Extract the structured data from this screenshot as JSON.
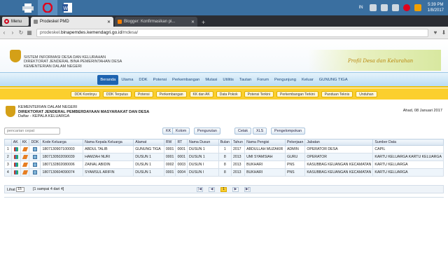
{
  "taskbar": {
    "apps": [
      {
        "name": "printer"
      },
      {
        "name": "opera",
        "active": true
      },
      {
        "name": "word"
      }
    ],
    "lang": "IN",
    "time": "5:39 PM",
    "date": "1/8/2017"
  },
  "browser": {
    "menu_label": "Menu",
    "tabs": [
      {
        "title": "Prodeskel PMD",
        "active": true
      },
      {
        "title": "Blogger: Konfirmasikan pi...",
        "active": false
      }
    ],
    "url_prefix": "prodeskel.",
    "url_host": "binapemdes.kemendagri.go.id",
    "url_path": "/mdesa/"
  },
  "header": {
    "line1": "SISTEM INFORMASI DESA DAN KELURAHAN",
    "line2": "DIREKTORAT JENDERAL BINA PEMERINTAHAN DESA",
    "line3": "KEMENTERIAN DALAM NEGERI",
    "banner": "Profil Desa dan Kelurahan"
  },
  "main_nav": [
    "Beranda",
    "Utama",
    "DDK",
    "Potensi",
    "Perkembangan",
    "Mutasi",
    "Utilitis",
    "Tautan",
    "Forum",
    "Pengunjung",
    "Keluar",
    "GUNUNG TIGA"
  ],
  "main_nav_active": "Beranda",
  "sub_nav": [
    "DDK Kontinyu",
    "DDK Terputus",
    "Potensi",
    "Perkembangan",
    "KK dan AK",
    "Data Pokok",
    "Potensi Terkini",
    "Perkembangan Terkini",
    "Panduan Teknis",
    "Unduhan"
  ],
  "context": {
    "org1": "KEMENTERIAN DALAM NEGERI",
    "org2": "DIREKTORAT JENDERAL PEMBERDAYAAN MASYARAKAT DAN DESA",
    "subtitle": "Daftar - KEPALA KELUARGA",
    "date": "Ahad, 08 Januari 2017"
  },
  "toolbar": {
    "search_placeholder": "pencarian cepat",
    "kk_baru": "KK Baru",
    "kolom": "Kolom",
    "pengurutan": "Pengurutan",
    "cetak": "Cetak",
    "xls": "XLS",
    "pengelompokan": "Pengelompokan"
  },
  "table": {
    "headers": [
      "AK",
      "KK",
      "DDK",
      "Kode Keluarga",
      "Nama Kepala Keluarga",
      "Alamat",
      "RW",
      "RT",
      "Nama Dusun",
      "Bulan",
      "Tahun",
      "Nama Pengisi",
      "Pekerjaan",
      "Jabatan",
      "Sumber Data"
    ],
    "rows": [
      {
        "no": "1",
        "kode": "1807130907100003",
        "nama": "ABDUL TALIB",
        "alamat": "GUNUNG TIGA",
        "rw": "0001",
        "rt": "0001",
        "dusun": "DUSUN 1",
        "bulan": "1",
        "tahun": "2017",
        "pengisi": "ABDULLAH MUZAKIR",
        "pekerjaan": "ADMIN",
        "jabatan": "OPERATOR DESA",
        "sumber": "CAPIL"
      },
      {
        "no": "2",
        "kode": "1807130502090039",
        "nama": "HAMZAH NURI",
        "alamat": "DUSUN 1",
        "rw": "0001",
        "rt": "0001",
        "dusun": "DUSUN 1",
        "bulan": "8",
        "tahun": "2013",
        "pengisi": "UMI SYAMSIAH",
        "pekerjaan": "GURU",
        "jabatan": "OPERATOR",
        "sumber": "KARTU KELUARGA KARTU KELUARGA"
      },
      {
        "no": "3",
        "kode": "1807132802080006",
        "nama": "ZAINAL ABIDIN",
        "alamat": "DUSUN 1",
        "rw": "0002",
        "rt": "0003",
        "dusun": "DUSUN I",
        "bulan": "8",
        "tahun": "2013",
        "pengisi": "BUKHARI",
        "pekerjaan": "PNS",
        "jabatan": "KASUBBAG KEUANGAN KECAMATAN",
        "sumber": "KARTU KELUARGA"
      },
      {
        "no": "4",
        "kode": "1807130604090074",
        "nama": "SYAMSUL ARIFIN",
        "alamat": "DUSUN 1",
        "rw": "0001",
        "rt": "0004",
        "dusun": "DUSUN I",
        "bulan": "8",
        "tahun": "2013",
        "pengisi": "BUKHARI",
        "pekerjaan": "PNS",
        "jabatan": "KASUBBAG KEUANGAN KECAMATAN",
        "sumber": "KARTU KELUARGA"
      }
    ]
  },
  "pager": {
    "lihat": "Lihat",
    "per_page": "15",
    "info": "[1 sampai 4 dari 4]",
    "first": "|◀",
    "prev": "◀",
    "page": "1",
    "next": "▶",
    "last": "▶|"
  }
}
